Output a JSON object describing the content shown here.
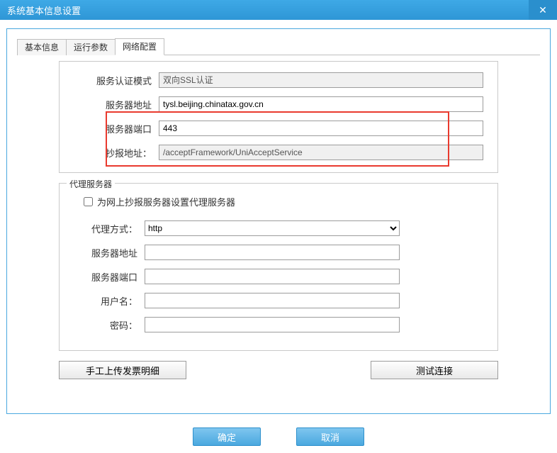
{
  "window": {
    "title": "系统基本信息设置",
    "close_glyph": "✕"
  },
  "tabs": {
    "items": [
      {
        "label": "基本信息",
        "active": false
      },
      {
        "label": "运行参数",
        "active": false
      },
      {
        "label": "网络配置",
        "active": true
      }
    ]
  },
  "server": {
    "auth_mode_label": "服务认证模式",
    "auth_mode_value": "双向SSL认证",
    "address_label": "服务器地址",
    "address_value": "tysl.beijing.chinatax.gov.cn",
    "port_label": "服务器端口",
    "port_value": "443",
    "report_addr_label": "抄报地址：",
    "report_addr_value": "/acceptFramework/UniAcceptService"
  },
  "proxy": {
    "legend": "代理服务器",
    "checkbox_label": "为网上抄报服务器设置代理服务器",
    "checkbox_checked": false,
    "method_label": "代理方式：",
    "method_value": "http",
    "method_options": [
      "http"
    ],
    "address_label": "服务器地址",
    "address_value": "",
    "port_label": "服务器端口",
    "port_value": "",
    "user_label": "用户名：",
    "user_value": "",
    "password_label": "密码：",
    "password_value": ""
  },
  "buttons": {
    "manual_upload": "手工上传发票明细",
    "test_connection": "测试连接",
    "ok": "确定",
    "cancel": "取消"
  }
}
